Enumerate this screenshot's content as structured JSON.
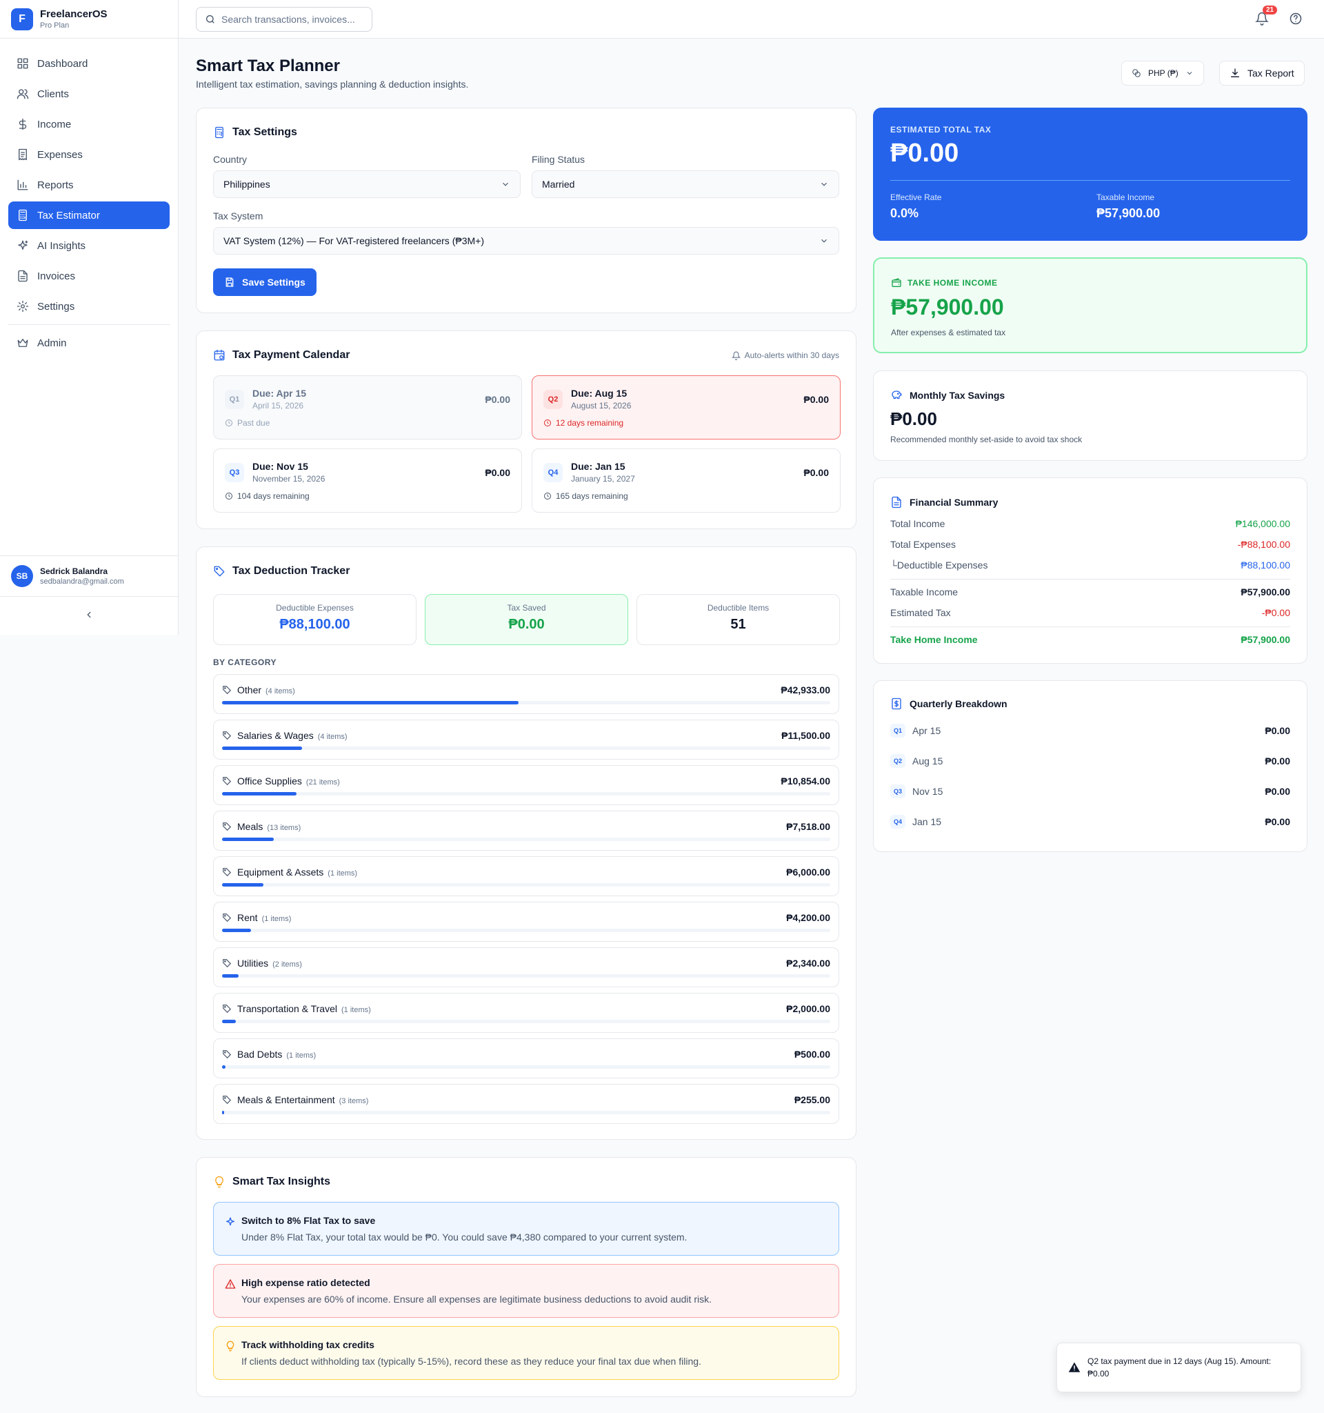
{
  "app": {
    "logo_letter": "F",
    "name": "FreelancerOS",
    "plan": "Pro Plan"
  },
  "sidebar": {
    "items": [
      {
        "label": "Dashboard",
        "icon": "grid-icon"
      },
      {
        "label": "Clients",
        "icon": "users-icon"
      },
      {
        "label": "Income",
        "icon": "dollar-icon"
      },
      {
        "label": "Expenses",
        "icon": "receipt-icon"
      },
      {
        "label": "Reports",
        "icon": "bar-chart-icon"
      },
      {
        "label": "Tax Estimator",
        "icon": "calculator-icon",
        "active": true
      },
      {
        "label": "AI Insights",
        "icon": "sparkles-icon"
      },
      {
        "label": "Invoices",
        "icon": "file-icon"
      },
      {
        "label": "Settings",
        "icon": "gear-icon"
      },
      {
        "label": "Admin",
        "icon": "crown-icon"
      }
    ]
  },
  "user": {
    "initials": "SB",
    "name": "Sedrick Balandra",
    "email": "sedbalandra@gmail.com"
  },
  "topbar": {
    "search_placeholder": "Search transactions, invoices...",
    "notification_count": "21"
  },
  "header": {
    "title": "Smart Tax Planner",
    "subtitle": "Intelligent tax estimation, savings planning & deduction insights.",
    "currency_label": "PHP (₱)",
    "report_label": "Tax Report"
  },
  "settings": {
    "title": "Tax Settings",
    "country_label": "Country",
    "country_value": "Philippines",
    "filing_label": "Filing Status",
    "filing_value": "Married",
    "system_label": "Tax System",
    "system_value": "VAT System (12%) — For VAT-registered freelancers (₱3M+)",
    "save_label": "Save Settings"
  },
  "calendar": {
    "title": "Tax Payment Calendar",
    "alerts": "Auto-alerts within 30 days",
    "quarters": [
      {
        "badge": "Q1",
        "due": "Due: Apr 15",
        "date": "April 15, 2026",
        "amount": "₱0.00",
        "status": "Past due",
        "state": "past"
      },
      {
        "badge": "Q2",
        "due": "Due: Aug 15",
        "date": "August 15, 2026",
        "amount": "₱0.00",
        "status": "12 days remaining",
        "state": "alert"
      },
      {
        "badge": "Q3",
        "due": "Due: Nov 15",
        "date": "November 15, 2026",
        "amount": "₱0.00",
        "status": "104 days remaining",
        "state": "normal"
      },
      {
        "badge": "Q4",
        "due": "Due: Jan 15",
        "date": "January 15, 2027",
        "amount": "₱0.00",
        "status": "165 days remaining",
        "state": "normal"
      }
    ]
  },
  "deductions": {
    "title": "Tax Deduction Tracker",
    "stats": [
      {
        "label": "Deductible Expenses",
        "value": "₱88,100.00"
      },
      {
        "label": "Tax Saved",
        "value": "₱0.00"
      },
      {
        "label": "Deductible Items",
        "value": "51"
      }
    ],
    "by_category_label": "BY CATEGORY",
    "categories": [
      {
        "name": "Other",
        "count": "(4 items)",
        "amount": "₱42,933.00",
        "share": 0.487
      },
      {
        "name": "Salaries & Wages",
        "count": "(4 items)",
        "amount": "₱11,500.00",
        "share": 0.131
      },
      {
        "name": "Office Supplies",
        "count": "(21 items)",
        "amount": "₱10,854.00",
        "share": 0.123
      },
      {
        "name": "Meals",
        "count": "(13 items)",
        "amount": "₱7,518.00",
        "share": 0.085
      },
      {
        "name": "Equipment & Assets",
        "count": "(1 items)",
        "amount": "₱6,000.00",
        "share": 0.068
      },
      {
        "name": "Rent",
        "count": "(1 items)",
        "amount": "₱4,200.00",
        "share": 0.048
      },
      {
        "name": "Utilities",
        "count": "(2 items)",
        "amount": "₱2,340.00",
        "share": 0.027
      },
      {
        "name": "Transportation & Travel",
        "count": "(1 items)",
        "amount": "₱2,000.00",
        "share": 0.023
      },
      {
        "name": "Bad Debts",
        "count": "(1 items)",
        "amount": "₱500.00",
        "share": 0.006
      },
      {
        "name": "Meals & Entertainment",
        "count": "(3 items)",
        "amount": "₱255.00",
        "share": 0.003
      }
    ]
  },
  "insights": {
    "title": "Smart Tax Insights",
    "items": [
      {
        "heading": "Switch to 8% Flat Tax to save",
        "body": "Under 8% Flat Tax, your total tax would be ₱0. You could save ₱4,380 compared to your current system.",
        "tone": "blue",
        "icon": "sparkles-icon"
      },
      {
        "heading": "High expense ratio detected",
        "body": "Your expenses are 60% of income. Ensure all expenses are legitimate business deductions to avoid audit risk.",
        "tone": "red",
        "icon": "warning-icon"
      },
      {
        "heading": "Track withholding tax credits",
        "body": "If clients deduct withholding tax (typically 5-15%), record these as they reduce your final tax due when filing.",
        "tone": "amber",
        "icon": "lightbulb-icon"
      }
    ]
  },
  "estimate": {
    "label": "ESTIMATED TOTAL TAX",
    "value": "₱0.00",
    "rate_label": "Effective Rate",
    "rate": "0.0%",
    "taxable_label": "Taxable Income",
    "taxable": "₱57,900.00"
  },
  "takehome": {
    "label": "TAKE HOME INCOME",
    "value": "₱57,900.00",
    "note": "After expenses & estimated tax"
  },
  "savings": {
    "title": "Monthly Tax Savings",
    "value": "₱0.00",
    "note": "Recommended monthly set-aside to avoid tax shock"
  },
  "summary": {
    "title": "Financial Summary",
    "rows": [
      {
        "label": "Total Income",
        "value": "₱146,000.00",
        "color": "#16a34a"
      },
      {
        "label": "Total Expenses",
        "value": "-₱88,100.00",
        "color": "#dc2626"
      },
      {
        "label": "└Deductible Expenses",
        "value": "₱88,100.00",
        "color": "#2563eb"
      },
      {
        "label": "Taxable Income",
        "value": "₱57,900.00",
        "color": "#0f172a"
      },
      {
        "label": "Estimated Tax",
        "value": "-₱0.00",
        "color": "#dc2626"
      },
      {
        "label": "Take Home Income",
        "value": "₱57,900.00",
        "color": "#16a34a"
      }
    ]
  },
  "quarterly": {
    "title": "Quarterly Breakdown",
    "rows": [
      {
        "badge": "Q1",
        "label": "Apr 15",
        "value": "₱0.00"
      },
      {
        "badge": "Q2",
        "label": "Aug 15",
        "value": "₱0.00"
      },
      {
        "badge": "Q3",
        "label": "Nov 15",
        "value": "₱0.00"
      },
      {
        "badge": "Q4",
        "label": "Jan 15",
        "value": "₱0.00"
      }
    ]
  },
  "toast": {
    "message": "Q2 tax payment due in 12 days (Aug 15). Amount: ₱0.00"
  }
}
